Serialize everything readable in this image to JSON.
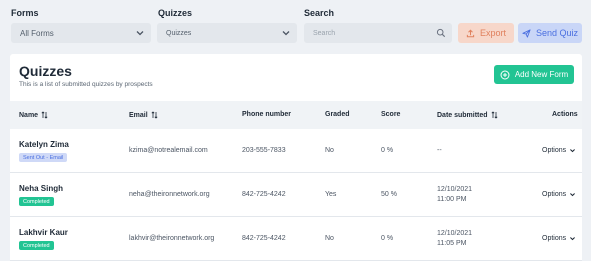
{
  "filters": {
    "forms": {
      "label": "Forms",
      "value": "All Forms"
    },
    "quizzes": {
      "label": "Quizzes",
      "value": "Quizzes"
    },
    "search": {
      "label": "Search",
      "placeholder": "Search"
    }
  },
  "actions": {
    "export_label": "Export",
    "send_quiz_label": "Send Quiz"
  },
  "card": {
    "title": "Quizzes",
    "subtitle": "This is a list of submitted quizzes by prospects",
    "add_button_label": "Add New Form"
  },
  "table": {
    "columns": {
      "name": "Name",
      "email": "Email",
      "phone": "Phone number",
      "graded": "Graded",
      "score": "Score",
      "date": "Date submitted",
      "actions": "Actions"
    },
    "rows": [
      {
        "name": "Katelyn Zima",
        "badge": "Sent Out - Email",
        "email": "kzima@notrealemail.com",
        "phone": "203-555-7833",
        "graded": "No",
        "score": "0 %",
        "date1": "--",
        "date2": "",
        "action": "Options"
      },
      {
        "name": "Neha Singh",
        "badge": "Completed",
        "email": "neha@theironnetwork.org",
        "phone": "842-725-4242",
        "graded": "Yes",
        "score": "50 %",
        "date1": "12/10/2021",
        "date2": "11:00 PM",
        "action": "Options"
      },
      {
        "name": "Lakhvir Kaur",
        "badge": "Completed",
        "email": "lakhvir@theironnetwork.org",
        "phone": "842-725-4242",
        "graded": "No",
        "score": "0 %",
        "date1": "12/10/2021",
        "date2": "11:05 PM",
        "action": "Options"
      }
    ]
  },
  "colors": {
    "accent_green": "#22c493",
    "accent_blue": "#4a6fe0",
    "export_orange": "#e0815e"
  }
}
